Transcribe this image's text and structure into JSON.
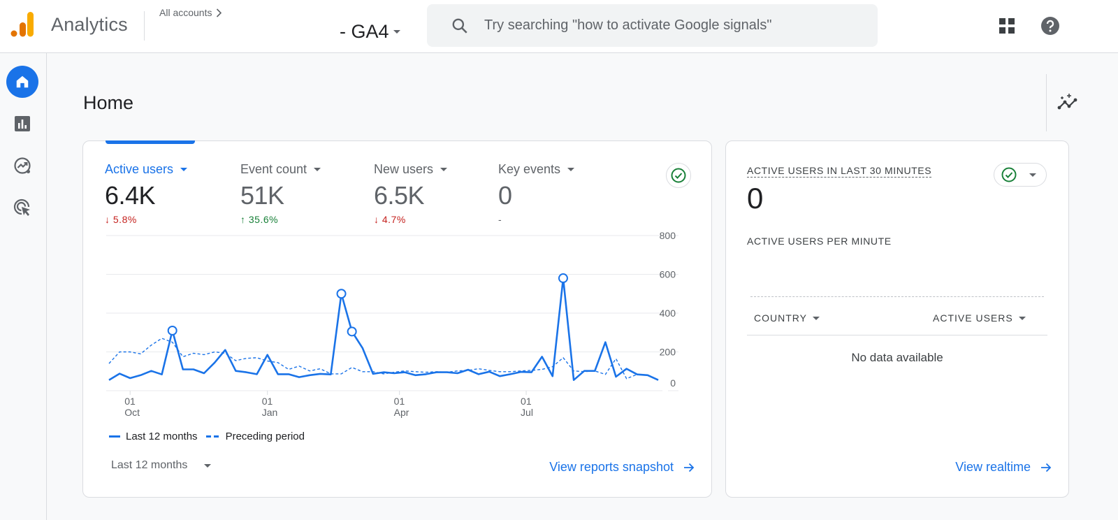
{
  "header": {
    "app_name": "Analytics",
    "breadcrumb": "All accounts",
    "property": "- GA4",
    "search_placeholder": "Try searching \"how to activate Google signals\"",
    "icons": [
      "apps-grid-icon",
      "help-icon"
    ]
  },
  "nav": {
    "items": [
      {
        "name": "home",
        "icon": "home-icon",
        "active": true
      },
      {
        "name": "reports",
        "icon": "bar-chart-icon",
        "active": false
      },
      {
        "name": "explore",
        "icon": "explore-icon",
        "active": false
      },
      {
        "name": "advertising",
        "icon": "advertising-icon",
        "active": false
      }
    ]
  },
  "page": {
    "title": "Home"
  },
  "main_card": {
    "metrics": [
      {
        "label": "Active users",
        "value": "6.4K",
        "delta": "5.8%",
        "direction": "down"
      },
      {
        "label": "Event count",
        "value": "51K",
        "delta": "35.6%",
        "direction": "up"
      },
      {
        "label": "New users",
        "value": "6.5K",
        "delta": "4.7%",
        "direction": "down"
      },
      {
        "label": "Key events",
        "value": "0",
        "delta": "-",
        "direction": "neutral"
      }
    ],
    "range_label": "Last 12 months",
    "link_label": "View reports snapshot"
  },
  "chart_data": {
    "type": "line",
    "title": "",
    "xlabel": "",
    "ylabel": "",
    "ylim": [
      0,
      800
    ],
    "y_ticks": [
      0,
      200,
      400,
      600,
      800
    ],
    "x_ticks": [
      {
        "index": 2,
        "label": [
          "01",
          "Oct"
        ]
      },
      {
        "index": 15,
        "label": [
          "01",
          "Jan"
        ]
      },
      {
        "index": 27.5,
        "label": [
          "01",
          "Apr"
        ]
      },
      {
        "index": 39.5,
        "label": [
          "01",
          "Jul"
        ]
      }
    ],
    "grid": true,
    "legend": "bottom-left",
    "series": [
      {
        "name": "Last 12 months",
        "style": "solid",
        "color": "#1a73e8",
        "values": [
          55,
          88,
          65,
          80,
          102,
          84,
          310,
          110,
          110,
          90,
          145,
          210,
          102,
          95,
          85,
          185,
          85,
          85,
          70,
          80,
          87,
          84,
          500,
          305,
          220,
          87,
          95,
          90,
          95,
          80,
          85,
          95,
          95,
          90,
          108,
          85,
          98,
          75,
          85,
          97,
          95,
          175,
          75,
          580,
          55,
          102,
          102,
          250,
          72,
          113,
          84,
          80,
          55
        ],
        "markers": [
          6,
          22,
          23,
          43
        ]
      },
      {
        "name": "Preceding period",
        "style": "dashed",
        "color": "#1a73e8",
        "values": [
          140,
          200,
          200,
          190,
          235,
          270,
          250,
          175,
          193,
          186,
          200,
          193,
          155,
          167,
          170,
          153,
          145,
          110,
          127,
          102,
          113,
          87,
          87,
          120,
          98,
          98,
          87,
          95,
          102,
          98,
          95,
          98,
          95,
          102,
          105,
          113,
          105,
          98,
          98,
          102,
          105,
          110,
          124,
          170,
          102,
          98,
          102,
          84,
          165,
          62,
          84,
          80,
          55
        ]
      }
    ]
  },
  "realtime_card": {
    "title": "ACTIVE USERS IN LAST 30 MINUTES",
    "value": "0",
    "subtitle": "ACTIVE USERS PER MINUTE",
    "columns": [
      "COUNTRY",
      "ACTIVE USERS"
    ],
    "empty_text": "No data available",
    "link_label": "View realtime"
  },
  "colors": {
    "accent": "#1a73e8",
    "negative": "#c5221f",
    "positive": "#188038",
    "status_ok": "#188038"
  }
}
